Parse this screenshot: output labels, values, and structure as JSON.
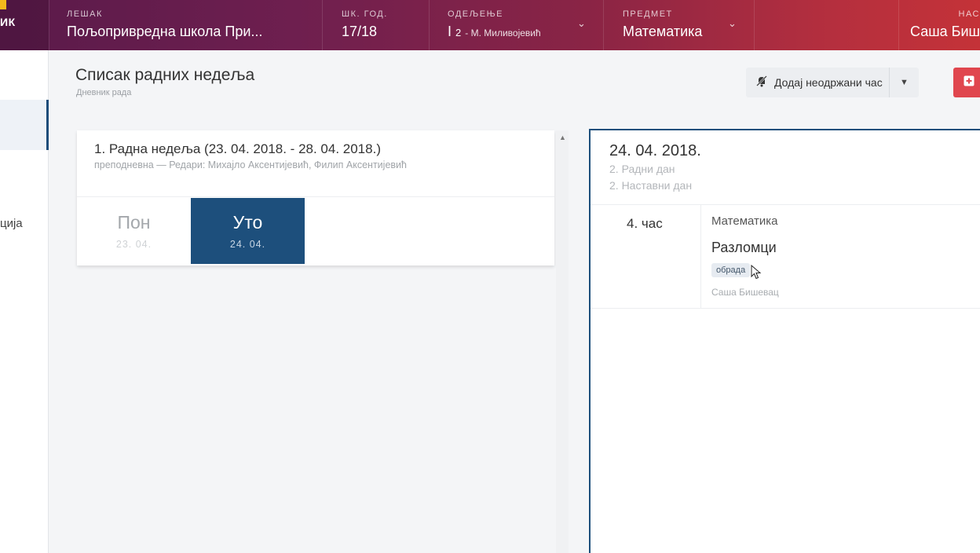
{
  "brand": {
    "text": "ИК"
  },
  "header": {
    "school_label": "ЛЕШАК",
    "school_value": "Пољопривредна школа При...",
    "year_label": "ШК. ГОД.",
    "year_value": "17/18",
    "dept_label": "ОДЕЉЕЊЕ",
    "dept_value_main": "I",
    "dept_value_sub": "2",
    "dept_value_teacher": "- М. Миливојевић",
    "subject_label": "ПРЕДМЕТ",
    "subject_value": "Математика",
    "teacher_label": "НАС",
    "teacher_value": "Саша Биш"
  },
  "sidebar": {
    "partial_label": "ција"
  },
  "page": {
    "title": "Списак радних недеља",
    "subtitle": "Дневник рада",
    "add_button_label": "Додај неодржани час",
    "red_button_icon": "plus-square-icon"
  },
  "week": {
    "title": "1. Радна недеља (23. 04. 2018. - 28. 04. 2018.)",
    "description": "преподневна — Редари: Михајло Аксентијевић, Филип Аксентијевић",
    "days": [
      {
        "name": "Пон",
        "date": "23. 04."
      },
      {
        "name": "Уто",
        "date": "24. 04."
      }
    ]
  },
  "day_detail": {
    "date": "24. 04. 2018.",
    "work_day": "2. Радни дан",
    "teaching_day": "2. Наставни дан",
    "lessons": [
      {
        "number": "4. час",
        "subject": "Математика",
        "topic": "Разломци",
        "type": "обрада",
        "teacher": "Саша Бишевац"
      }
    ]
  },
  "colors": {
    "accent": "#1d4f7c",
    "danger": "#e0464e",
    "brand_yellow": "#f2b81b"
  }
}
